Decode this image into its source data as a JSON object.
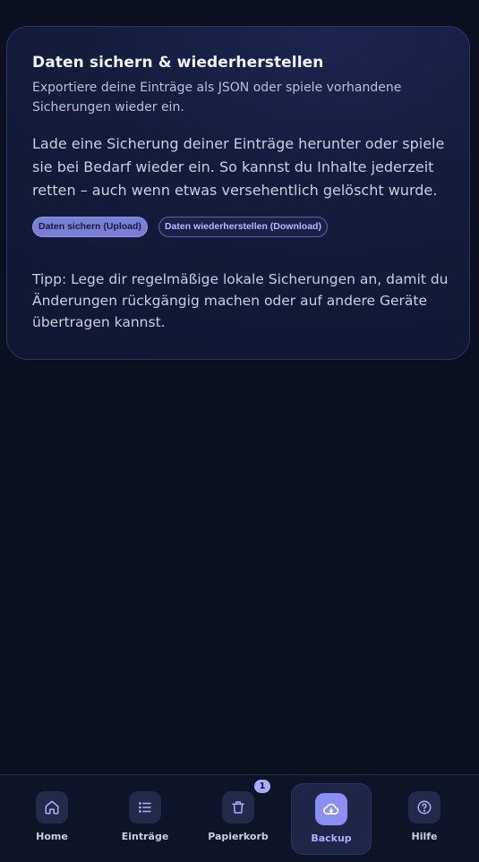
{
  "card": {
    "title": "Daten sichern & wiederherstellen",
    "subtitle": "Exportiere deine Einträge als JSON oder spiele vorhandene Sicherungen wieder ein.",
    "body": "Lade eine Sicherung deiner Einträge herunter oder spiele sie bei Bedarf wieder ein. So kannst du Inhalte jederzeit retten – auch wenn etwas versehentlich gelöscht wurde.",
    "backup_button": "Daten sichern (Upload)",
    "restore_button": "Daten wiederherstellen (Download)",
    "tip": "Tipp: Lege dir regelmäßige lokale Sicherungen an, damit du Änderungen rückgängig machen oder auf andere Geräte übertragen kannst."
  },
  "nav": {
    "items": [
      {
        "label": "Home",
        "icon": "home-icon"
      },
      {
        "label": "Einträge",
        "icon": "list-icon"
      },
      {
        "label": "Papierkorb",
        "icon": "trash-icon",
        "badge": "1"
      },
      {
        "label": "Backup",
        "icon": "cloud-icon",
        "active": true
      },
      {
        "label": "Hilfe",
        "icon": "help-icon"
      }
    ]
  },
  "colors": {
    "background": "#0b1020",
    "accent": "#8b8ef3",
    "accent_text": "#aab0ff"
  }
}
